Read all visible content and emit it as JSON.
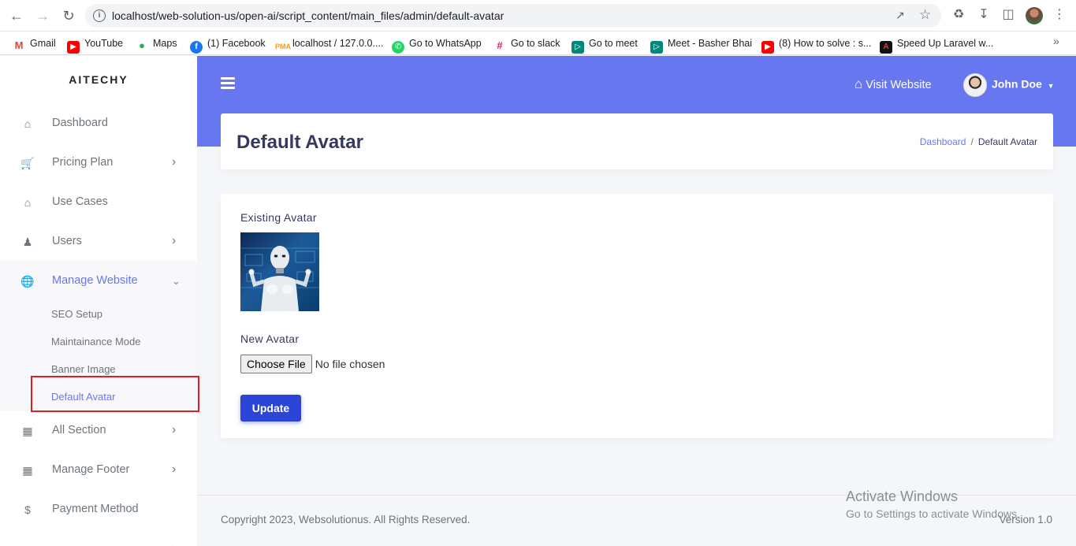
{
  "browser": {
    "url": "localhost/web-solution-us/open-ai/script_content/main_files/admin/default-avatar",
    "bookmarks": [
      {
        "label": "Gmail",
        "icon": "gmail-icon",
        "color": "#ea4335"
      },
      {
        "label": "YouTube",
        "icon": "youtube-icon",
        "color": "#ff0000"
      },
      {
        "label": "Maps",
        "icon": "maps-icon",
        "color": "#34a853"
      },
      {
        "label": "(1) Facebook",
        "icon": "facebook-icon",
        "color": "#1877f2"
      },
      {
        "label": "localhost / 127.0.0....",
        "icon": "phpmyadmin-icon",
        "color": "#f89c0e"
      },
      {
        "label": "Go to WhatsApp",
        "icon": "whatsapp-icon",
        "color": "#25d366"
      },
      {
        "label": "Go to slack",
        "icon": "slack-icon",
        "color": "#e01e5a"
      },
      {
        "label": "Go to meet",
        "icon": "meet-icon",
        "color": "#00897b"
      },
      {
        "label": "Meet - Basher Bhai",
        "icon": "meet-icon",
        "color": "#00897b"
      },
      {
        "label": "(8) How to solve : s...",
        "icon": "youtube-icon",
        "color": "#ff0000"
      },
      {
        "label": "Speed Up Laravel w...",
        "icon": "laravel-icon",
        "color": "#111111"
      }
    ]
  },
  "sidebar": {
    "brand": "AITECHY",
    "items": [
      {
        "label": "Dashboard",
        "icon": "home-icon",
        "has_arrow": false
      },
      {
        "label": "Pricing Plan",
        "icon": "cart-icon",
        "has_arrow": true
      },
      {
        "label": "Use Cases",
        "icon": "home-icon",
        "has_arrow": false
      },
      {
        "label": "Users",
        "icon": "users-icon",
        "has_arrow": true
      },
      {
        "label": "Manage Website",
        "icon": "globe-icon",
        "has_arrow": true,
        "active": true
      },
      {
        "label": "All Section",
        "icon": "grid-icon",
        "has_arrow": true
      },
      {
        "label": "Manage Footer",
        "icon": "grid-icon",
        "has_arrow": true
      },
      {
        "label": "Payment Method",
        "icon": "dollar-icon",
        "has_arrow": false
      }
    ],
    "submenu": [
      {
        "label": "SEO Setup"
      },
      {
        "label": "Maintainance Mode"
      },
      {
        "label": "Banner Image"
      },
      {
        "label": "Default Avatar",
        "active": true
      }
    ]
  },
  "topbar": {
    "visit_label": "Visit Website",
    "user_name": "John Doe"
  },
  "page": {
    "title": "Default Avatar",
    "breadcrumb": {
      "link": "Dashboard",
      "separator": "/",
      "current": "Default Avatar"
    }
  },
  "form": {
    "existing_label": "Existing Avatar",
    "new_label": "New Avatar",
    "choose_file": "Choose File",
    "no_file": "No file chosen",
    "update": "Update"
  },
  "footer": {
    "copyright": "Copyright 2023, Websolutionus. All Rights Reserved.",
    "version": "Version 1.0"
  },
  "watermark": {
    "line1": "Activate Windows",
    "line2": "Go to Settings to activate Windows."
  },
  "colors": {
    "primary": "#6777ef",
    "button": "#2d45d6",
    "highlight_box": "#e11d24"
  }
}
